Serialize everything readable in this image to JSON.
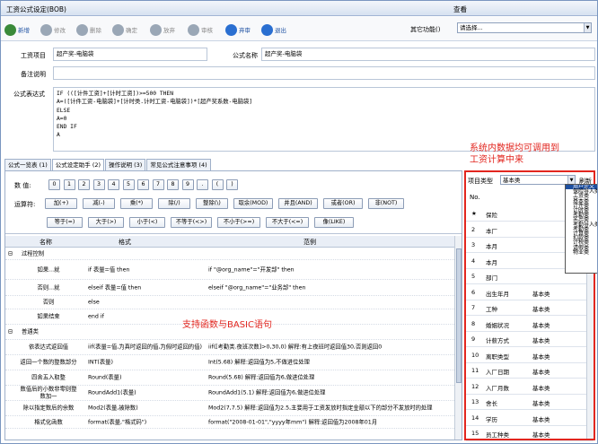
{
  "window": {
    "title": "工资公式设定(BOB)",
    "view_label": "查看"
  },
  "toolbar": {
    "buttons": [
      {
        "label": "新增",
        "enabled": true,
        "color": "#3a8a3a",
        "name": "add-button"
      },
      {
        "label": "修改",
        "enabled": false,
        "color": "#9aa7b6",
        "name": "edit-button"
      },
      {
        "label": "删除",
        "enabled": false,
        "color": "#9aa7b6",
        "name": "delete-button"
      },
      {
        "label": "确定",
        "enabled": false,
        "color": "#9aa7b6",
        "name": "confirm-button"
      },
      {
        "label": "放弃",
        "enabled": false,
        "color": "#9aa7b6",
        "name": "abandon-button"
      },
      {
        "label": "审核",
        "enabled": false,
        "color": "#9aa7b6",
        "name": "audit-button"
      },
      {
        "label": "弃审",
        "enabled": true,
        "color": "#2a6fd1",
        "name": "unaudit-button"
      },
      {
        "label": "退出",
        "enabled": true,
        "color": "#2a6fd1",
        "name": "exit-button"
      }
    ],
    "other_functions_label": "其它功能()",
    "other_functions_value": "请选择..."
  },
  "form": {
    "salary_item_label": "工资项目",
    "salary_item_value": "超产奖-电脑袋",
    "formula_name_label": "公式名称",
    "formula_name_value": "超产奖-电脑袋",
    "remark_label": "备注说明",
    "remark_value": "",
    "expression_label": "公式表达式",
    "expression": "IF (([计件工资]+[计时工资])>=500 THEN\nA=([计件工资-电脑袋]+[计时类.计时工资-电脑袋])*[超产奖系数-电脑袋]\nELSE\nA=0\nEND IF\nA"
  },
  "tabs": [
    "公式一览表 (1)",
    "公式设定助手 (2)",
    "操作说明 (3)",
    "常见公式注意事项 (4)"
  ],
  "helper": {
    "numbers_label": "数  值:",
    "numbers": [
      "0",
      "1",
      "2",
      "3",
      "4",
      "5",
      "6",
      "7",
      "8",
      "9",
      ".",
      "(",
      ")"
    ],
    "operators_label": "运算符:",
    "operators_row1": [
      "加(+)",
      "减(-)",
      "乘(*)",
      "除(/)",
      "整除(\\)",
      "取余(MOD)",
      "并且(AND)",
      "或者(OR)",
      "非(NOT)"
    ],
    "operators_row2": [
      "等于(=)",
      "大于(>)",
      "小于(<)",
      "不等于(<>)",
      "不小于(>=)",
      "不大于(<=)",
      "像(LIKE)"
    ]
  },
  "func_table": {
    "headers": [
      "名称",
      "格式",
      "范例"
    ],
    "rows": [
      {
        "indent": 0,
        "name": "过程控制",
        "format": "",
        "example": "",
        "group": true
      },
      {
        "indent": 1,
        "name": "如果...就",
        "format": "if 表量=值 then",
        "example": "if \"@org_name\"=\"开发部\" then"
      },
      {
        "indent": 1,
        "name": "否则...就",
        "format": "elseif 表量=值 then",
        "example": "elseif \"@org_name\"=\"业务部\" then"
      },
      {
        "indent": 1,
        "name": "否则",
        "format": "else",
        "example": ""
      },
      {
        "indent": 1,
        "name": "如果结束",
        "format": "end if",
        "example": ""
      },
      {
        "indent": 0,
        "name": "普通类",
        "format": "",
        "example": "",
        "group": true
      },
      {
        "indent": 1,
        "name": "依表达式返回值",
        "format": "iif(表量=值,为真时返回的值,为假时返回的值)",
        "example": "iif([考勤类.夜班次数]>0,30,0)  解释:有上夜班时返回值30,否则返回0"
      },
      {
        "indent": 1,
        "name": "返回一个数的整数部分",
        "format": "INT(表量)",
        "example": "Int(5.68)  解释:返回值为5,不做进位处理"
      },
      {
        "indent": 1,
        "name": "四舍五入取整",
        "format": "Round(表量)",
        "example": "Round(5.68)  解释:返回值为6,做进位处理"
      },
      {
        "indent": 1,
        "name": "数值后的小数非零则整数加一",
        "format": "RoundAdd1(表量)",
        "example": "RoundAdd1(5.1)  解释:返回值为6,做进位处理"
      },
      {
        "indent": 1,
        "name": "除以指定数后的余数",
        "format": "Mod2(表量,被除数)",
        "example": "Mod2(7,7.5)  解释:返回值为2.5,主要用于工资发放时指定金额以下的部分不发放时的处理"
      },
      {
        "indent": 1,
        "name": "格式化函数",
        "format": "format(表量,\"格式码\")",
        "example": "format(\"2008-01-01\",\"yyyy年mm\")  解释:返回值为2008年01月"
      }
    ]
  },
  "annotations": {
    "basic_note": "支持函数与BASIC语句",
    "system_note_line1": "系统内数据均可调用到",
    "system_note_line2": "工资计算中来"
  },
  "right_panel": {
    "type_label": "项目类型",
    "type_value": "基本类",
    "refresh_label": "刷新",
    "col_no": "No.",
    "dropdown_options": [
      "用户定义",
      "保险导入类",
      "工资类",
      "基本类",
      "计件类",
      "计时类",
      "考勤类",
      "奖惩类",
      "考勤导入类",
      "考勤类",
      "计算类",
      "扣款类",
      "计税类",
      "请假类",
      "物业类"
    ],
    "dropdown_selected_index": 0,
    "rows": [
      {
        "no": "★",
        "name": "保险",
        "type": ""
      },
      {
        "no": "2",
        "name": "本厂",
        "type": ""
      },
      {
        "no": "3",
        "name": "本月",
        "type": ""
      },
      {
        "no": "4",
        "name": "本月",
        "type": ""
      },
      {
        "no": "5",
        "name": "部门",
        "type": ""
      },
      {
        "no": "6",
        "name": "出生年月",
        "type": "基本类"
      },
      {
        "no": "7",
        "name": "工种",
        "type": "基本类"
      },
      {
        "no": "8",
        "name": "婚姻状况",
        "type": "基本类"
      },
      {
        "no": "9",
        "name": "计薪方式",
        "type": "基本类"
      },
      {
        "no": "10",
        "name": "离职类型",
        "type": "基本类"
      },
      {
        "no": "11",
        "name": "入厂日期",
        "type": "基本类"
      },
      {
        "no": "12",
        "name": "入厂月数",
        "type": "基本类"
      },
      {
        "no": "13",
        "name": "舍长",
        "type": "基本类"
      },
      {
        "no": "14",
        "name": "学历",
        "type": "基本类"
      },
      {
        "no": "15",
        "name": "员工种类",
        "type": "基本类"
      }
    ]
  }
}
